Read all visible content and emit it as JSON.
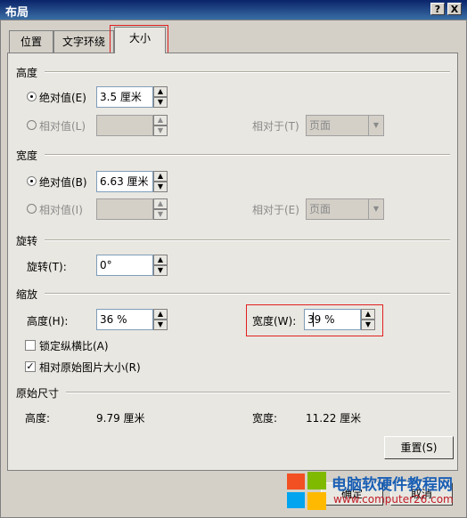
{
  "dialog": {
    "title": "布局",
    "help_label": "?",
    "close_label": "X"
  },
  "tabs": [
    "位置",
    "文字环绕",
    "大小"
  ],
  "height": {
    "section": "高度",
    "absolute_label": "绝对值(E)",
    "absolute_value": "3.5 厘米",
    "relative_label": "相对值(L)",
    "relative_to_label": "相对于(T)",
    "relative_to_value": "页面"
  },
  "width": {
    "section": "宽度",
    "absolute_label": "绝对值(B)",
    "absolute_value": "6.63 厘米",
    "relative_label": "相对值(I)",
    "relative_to_label": "相对于(E)",
    "relative_to_value": "页面"
  },
  "rotate": {
    "section": "旋转",
    "label": "旋转(T):",
    "value": "0°"
  },
  "scale": {
    "section": "缩放",
    "height_label": "高度(H):",
    "height_value": "36 %",
    "width_label": "宽度(W):",
    "width_value": "39 %",
    "lock_label": "锁定纵横比(A)",
    "relative_label": "相对原始图片大小(R)"
  },
  "original": {
    "section": "原始尺寸",
    "height_label": "高度:",
    "height_value": "9.79 厘米",
    "width_label": "宽度:",
    "width_value": "11.22 厘米"
  },
  "buttons": {
    "reset": "重置(S)",
    "ok": "确定",
    "cancel": "取消"
  },
  "watermark": {
    "text": "电脑软硬件教程网",
    "url": "www.computer26.com"
  }
}
